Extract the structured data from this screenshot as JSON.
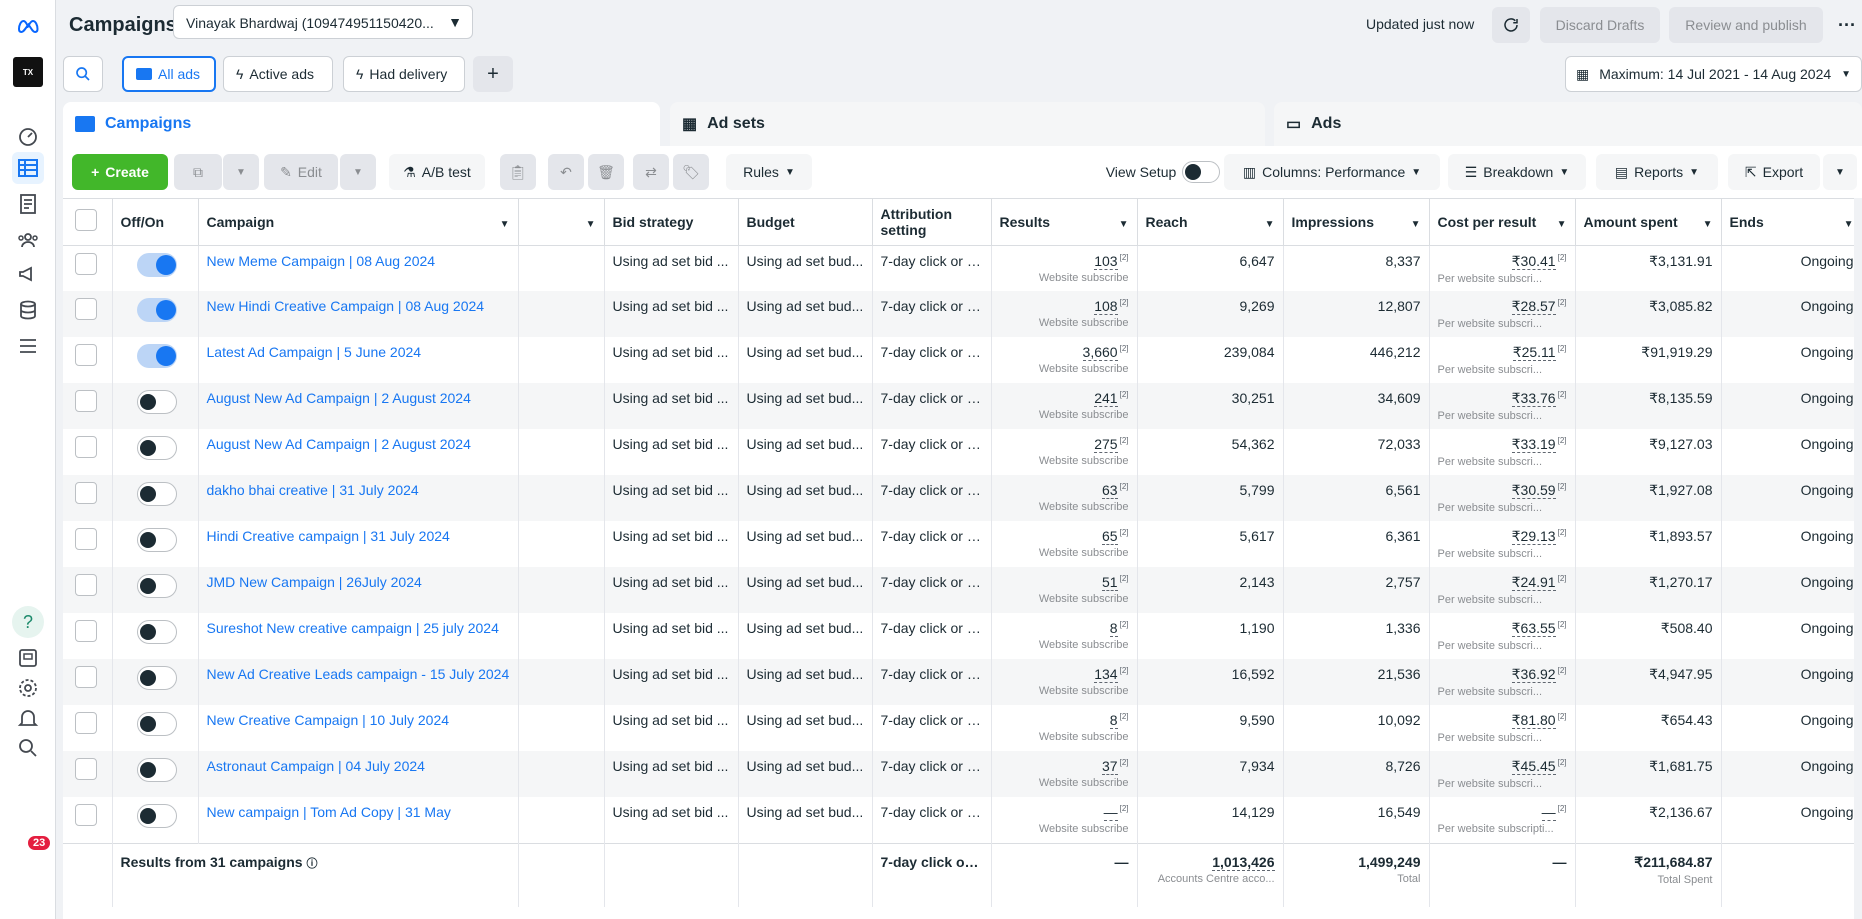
{
  "header": {
    "title": "Campaigns",
    "account": "Vinayak Bhardwaj (109474951150420...",
    "updated": "Updated just now",
    "discard": "Discard Drafts",
    "review": "Review and publish"
  },
  "filters": {
    "all_ads": "All ads",
    "active_ads": "Active ads",
    "had_delivery": "Had delivery",
    "date_range": "Maximum: 14 Jul 2021 - 14 Aug 2024"
  },
  "tabs": {
    "campaigns": "Campaigns",
    "adsets": "Ad sets",
    "ads": "Ads"
  },
  "toolbar": {
    "create": "Create",
    "edit": "Edit",
    "ab_test": "A/B test",
    "rules": "Rules",
    "view_setup": "View Setup",
    "columns": "Columns: Performance",
    "breakdown": "Breakdown",
    "reports": "Reports",
    "export": "Export"
  },
  "table": {
    "headers": {
      "offon": "Off/On",
      "campaign": "Campaign",
      "bid": "Bid strategy",
      "budget": "Budget",
      "attr": "Attribution setting",
      "results": "Results",
      "reach": "Reach",
      "impressions": "Impressions",
      "cpr": "Cost per result",
      "spent": "Amount spent",
      "ends": "Ends"
    },
    "rows": [
      {
        "on": true,
        "name": "New Meme Campaign | 08 Aug 2024",
        "bid": "Using ad set bid ...",
        "budget": "Using ad set bud...",
        "attr": "7-day click or 1...",
        "results": "103",
        "result_type": "Website subscribe",
        "reach": "6,647",
        "impressions": "8,337",
        "cpr": "₹30.41",
        "cpr_type": "Per website subscri...",
        "spent": "₹3,131.91",
        "ends": "Ongoing"
      },
      {
        "on": true,
        "name": "New Hindi Creative Campaign | 08 Aug 2024",
        "bid": "Using ad set bid ...",
        "budget": "Using ad set bud...",
        "attr": "7-day click or 1...",
        "results": "108",
        "result_type": "Website subscribe",
        "reach": "9,269",
        "impressions": "12,807",
        "cpr": "₹28.57",
        "cpr_type": "Per website subscri...",
        "spent": "₹3,085.82",
        "ends": "Ongoing"
      },
      {
        "on": true,
        "name": "Latest Ad Campaign | 5 June 2024",
        "bid": "Using ad set bid ...",
        "budget": "Using ad set bud...",
        "attr": "7-day click or 1...",
        "results": "3,660",
        "result_type": "Website subscribe",
        "reach": "239,084",
        "impressions": "446,212",
        "cpr": "₹25.11",
        "cpr_type": "Per website subscri...",
        "spent": "₹91,919.29",
        "ends": "Ongoing"
      },
      {
        "on": false,
        "name": "August New Ad Campaign | 2 August 2024",
        "bid": "Using ad set bid ...",
        "budget": "Using ad set bud...",
        "attr": "7-day click or 1...",
        "results": "241",
        "result_type": "Website subscribe",
        "reach": "30,251",
        "impressions": "34,609",
        "cpr": "₹33.76",
        "cpr_type": "Per website subscri...",
        "spent": "₹8,135.59",
        "ends": "Ongoing"
      },
      {
        "on": false,
        "name": "August New Ad Campaign | 2 August 2024",
        "bid": "Using ad set bid ...",
        "budget": "Using ad set bud...",
        "attr": "7-day click or 1...",
        "results": "275",
        "result_type": "Website subscribe",
        "reach": "54,362",
        "impressions": "72,033",
        "cpr": "₹33.19",
        "cpr_type": "Per website subscri...",
        "spent": "₹9,127.03",
        "ends": "Ongoing"
      },
      {
        "on": false,
        "name": "dakho bhai creative | 31 July 2024",
        "bid": "Using ad set bid ...",
        "budget": "Using ad set bud...",
        "attr": "7-day click or 1...",
        "results": "63",
        "result_type": "Website subscribe",
        "reach": "5,799",
        "impressions": "6,561",
        "cpr": "₹30.59",
        "cpr_type": "Per website subscri...",
        "spent": "₹1,927.08",
        "ends": "Ongoing"
      },
      {
        "on": false,
        "name": "Hindi Creative campaign | 31 July 2024",
        "bid": "Using ad set bid ...",
        "budget": "Using ad set bud...",
        "attr": "7-day click or 1...",
        "results": "65",
        "result_type": "Website subscribe",
        "reach": "5,617",
        "impressions": "6,361",
        "cpr": "₹29.13",
        "cpr_type": "Per website subscri...",
        "spent": "₹1,893.57",
        "ends": "Ongoing"
      },
      {
        "on": false,
        "name": "JMD New Campaign | 26July 2024",
        "bid": "Using ad set bid ...",
        "budget": "Using ad set bud...",
        "attr": "7-day click or 1...",
        "results": "51",
        "result_type": "Website subscribe",
        "reach": "2,143",
        "impressions": "2,757",
        "cpr": "₹24.91",
        "cpr_type": "Per website subscri...",
        "spent": "₹1,270.17",
        "ends": "Ongoing"
      },
      {
        "on": false,
        "name": "Sureshot New creative campaign | 25 july 2024",
        "bid": "Using ad set bid ...",
        "budget": "Using ad set bud...",
        "attr": "7-day click or 1...",
        "results": "8",
        "result_type": "Website subscribe",
        "reach": "1,190",
        "impressions": "1,336",
        "cpr": "₹63.55",
        "cpr_type": "Per website subscri...",
        "spent": "₹508.40",
        "ends": "Ongoing"
      },
      {
        "on": false,
        "name": "New Ad Creative Leads campaign - 15 July 2024",
        "bid": "Using ad set bid ...",
        "budget": "Using ad set bud...",
        "attr": "7-day click or 1...",
        "results": "134",
        "result_type": "Website subscribe",
        "reach": "16,592",
        "impressions": "21,536",
        "cpr": "₹36.92",
        "cpr_type": "Per website subscri...",
        "spent": "₹4,947.95",
        "ends": "Ongoing"
      },
      {
        "on": false,
        "name": "New Creative Campaign | 10 July 2024",
        "bid": "Using ad set bid ...",
        "budget": "Using ad set bud...",
        "attr": "7-day click or 1...",
        "results": "8",
        "result_type": "Website subscribe",
        "reach": "9,590",
        "impressions": "10,092",
        "cpr": "₹81.80",
        "cpr_type": "Per website subscri...",
        "spent": "₹654.43",
        "ends": "Ongoing"
      },
      {
        "on": false,
        "name": "Astronaut Campaign | 04 July 2024",
        "bid": "Using ad set bid ...",
        "budget": "Using ad set bud...",
        "attr": "7-day click or 1...",
        "results": "37",
        "result_type": "Website subscribe",
        "reach": "7,934",
        "impressions": "8,726",
        "cpr": "₹45.45",
        "cpr_type": "Per website subscri...",
        "spent": "₹1,681.75",
        "ends": "Ongoing"
      },
      {
        "on": false,
        "name": "New campaign | Tom Ad Copy | 31 May",
        "bid": "Using ad set bid ...",
        "budget": "Using ad set bud...",
        "attr": "7-day click or 1...",
        "results": "—",
        "result_type": "Website subscribe",
        "reach": "14,129",
        "impressions": "16,549",
        "cpr": "—",
        "cpr_type": "Per website subscripti...",
        "spent": "₹2,136.67",
        "ends": "Ongoing"
      }
    ],
    "totals": {
      "label": "Results from 31 campaigns",
      "attr": "7-day click or ...",
      "results": "—",
      "reach": "1,013,426",
      "reach_sub": "Accounts Centre acco...",
      "impressions": "1,499,249",
      "impressions_sub": "Total",
      "cpr": "—",
      "spent": "₹211,684.87",
      "spent_sub": "Total Spent"
    }
  },
  "notifications": {
    "count": "23"
  },
  "colors": {
    "brand": "#1877f2",
    "create": "#42b72a",
    "badge": "#e41e3f"
  }
}
